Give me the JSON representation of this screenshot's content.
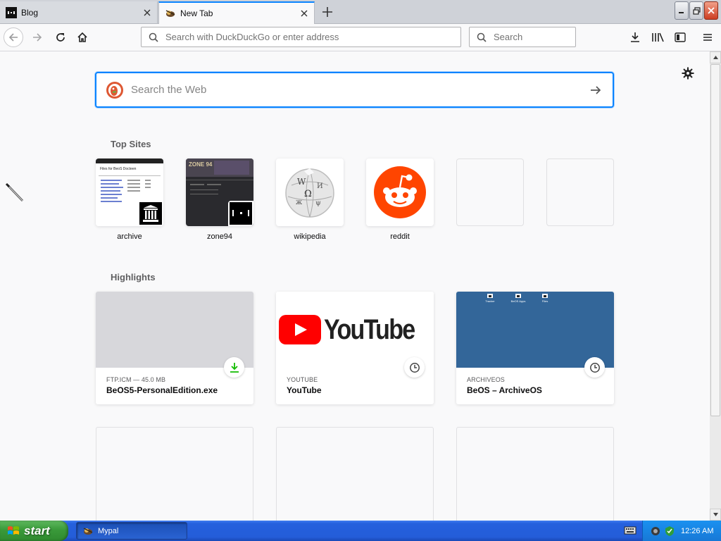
{
  "tabs": [
    {
      "title": "Blog",
      "active": false
    },
    {
      "title": "New Tab",
      "active": true
    }
  ],
  "navbar": {
    "url_placeholder": "Search with DuckDuckGo or enter address",
    "search_placeholder": "Search"
  },
  "newtab": {
    "websearch_placeholder": "Search the Web",
    "top_sites_title": "Top Sites",
    "highlights_title": "Highlights",
    "top_sites": [
      {
        "label": "archive"
      },
      {
        "label": "zone94"
      },
      {
        "label": "wikipedia"
      },
      {
        "label": "reddit"
      },
      {
        "label": ""
      },
      {
        "label": ""
      }
    ],
    "highlights": [
      {
        "meta": "FTP.ICM — 45.0 MB",
        "title": "BeOS5-PersonalEdition.exe",
        "icon": "download-icon"
      },
      {
        "meta": "YOUTUBE",
        "title": "YouTube",
        "icon": "clock-icon"
      },
      {
        "meta": "ARCHIVEOS",
        "title": "BeOS – ArchiveOS",
        "icon": "clock-icon"
      }
    ],
    "archive_thumb_heading": "Files for BeoS Docteen",
    "zone94_thumb_heading": "ZONE 94",
    "youtube_logo_text": "YouTube",
    "archiveos_icon_labels": [
      "Tracker",
      "BeOS Apps",
      "Files"
    ]
  },
  "taskbar": {
    "start_label": "start",
    "task_label": "Mypal",
    "clock": "12:26 AM"
  },
  "colors": {
    "accent": "#0a84ff",
    "reddit": "#ff4500",
    "youtube_red": "#ff0000",
    "archiveos_blue": "#336699",
    "download_green": "#12bc00"
  }
}
